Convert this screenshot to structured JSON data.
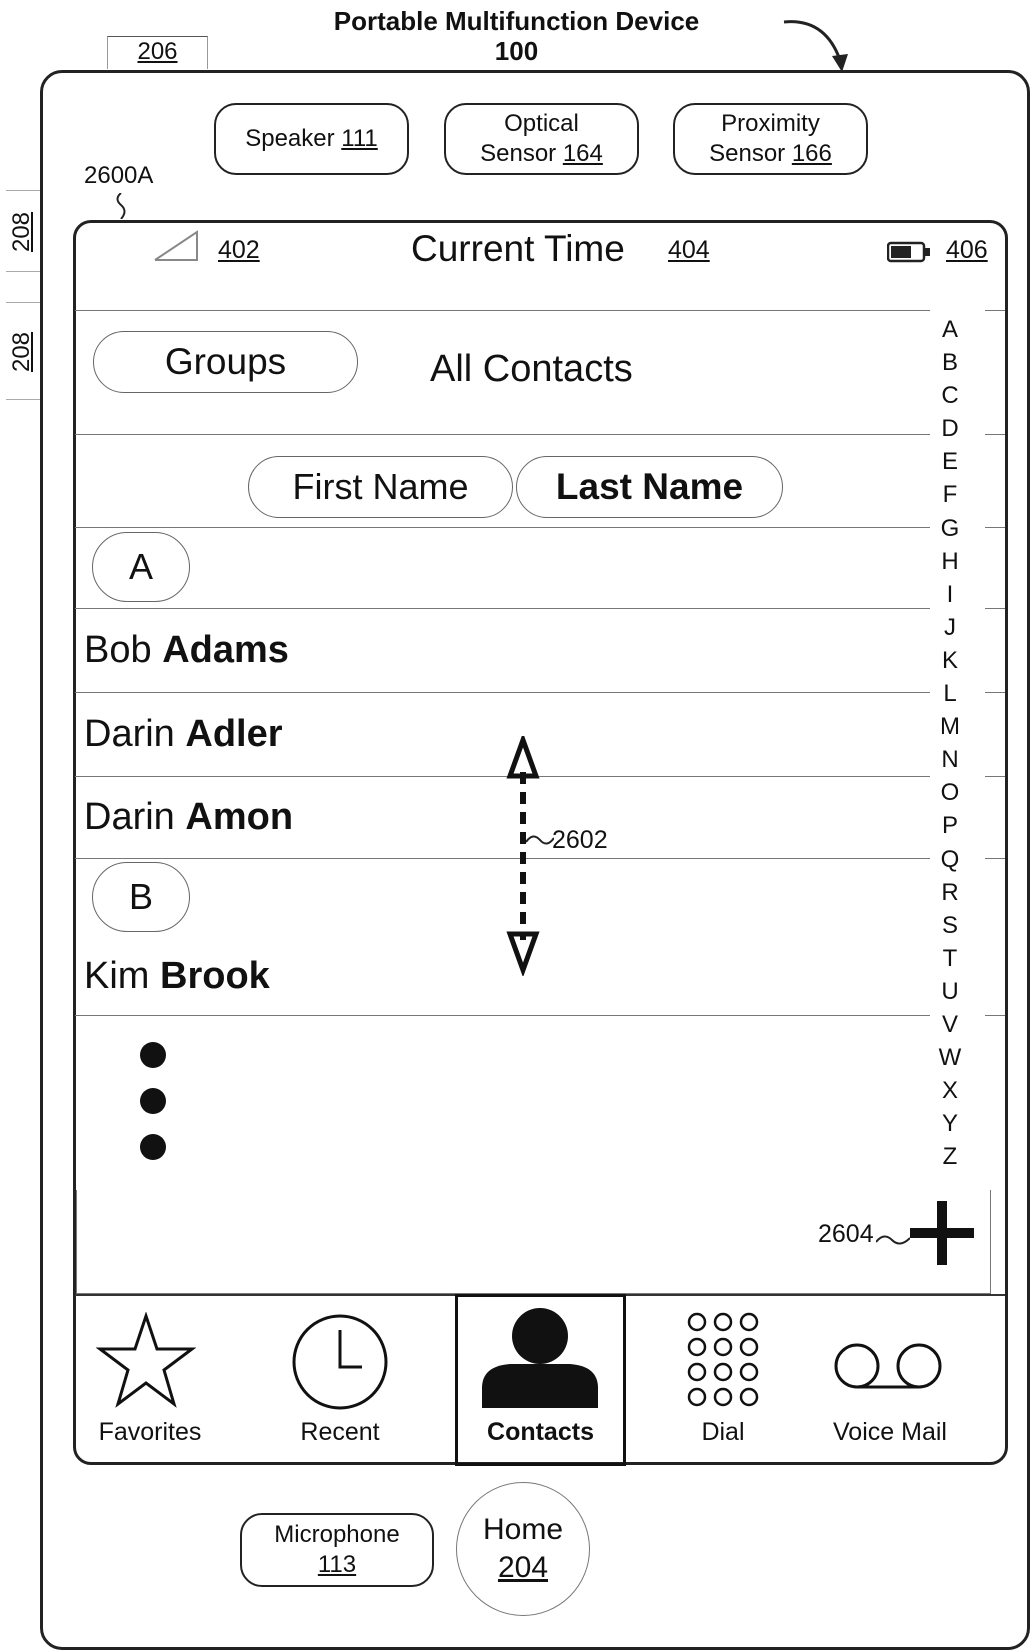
{
  "device": {
    "title": "Portable Multifunction Device",
    "number": "100",
    "ref_206": "206",
    "ref_208_a": "208",
    "ref_208_b": "208",
    "ref_2600A": "2600A"
  },
  "hardware": {
    "speaker_label": "Speaker",
    "speaker_ref": "111",
    "optical_label_1": "Optical",
    "optical_label_2": "Sensor",
    "optical_ref": "164",
    "proximity_label_1": "Proximity",
    "proximity_label_2": "Sensor",
    "proximity_ref": "166",
    "microphone_label": "Microphone",
    "microphone_ref": "113",
    "home_label": "Home",
    "home_ref": "204"
  },
  "status_bar": {
    "signal_ref": "402",
    "time_label": "Current Time",
    "time_ref": "404",
    "battery_ref": "406"
  },
  "header": {
    "groups_button": "Groups",
    "title": "All Contacts"
  },
  "sort": {
    "first_name": "First Name",
    "last_name": "Last Name",
    "selected": "Last Name"
  },
  "contacts": {
    "section_a": "A",
    "section_b": "B",
    "rows": [
      {
        "first": "Bob",
        "last": "Adams"
      },
      {
        "first": "Darin",
        "last": "Adler"
      },
      {
        "first": "Darin",
        "last": "Amon"
      },
      {
        "first": "Kim",
        "last": "Brook"
      }
    ]
  },
  "annotations": {
    "scroll_ref": "2602",
    "add_ref": "2604"
  },
  "alphabet_index": [
    "A",
    "B",
    "C",
    "D",
    "E",
    "F",
    "G",
    "H",
    "I",
    "J",
    "K",
    "L",
    "M",
    "N",
    "O",
    "P",
    "Q",
    "R",
    "S",
    "T",
    "U",
    "V",
    "W",
    "X",
    "Y",
    "Z"
  ],
  "tabs": [
    {
      "label": "Favorites",
      "icon": "star-icon"
    },
    {
      "label": "Recent",
      "icon": "clock-icon"
    },
    {
      "label": "Contacts",
      "icon": "person-icon",
      "active": true
    },
    {
      "label": "Dial",
      "icon": "keypad-icon"
    },
    {
      "label": "Voice Mail",
      "icon": "voicemail-icon"
    }
  ]
}
